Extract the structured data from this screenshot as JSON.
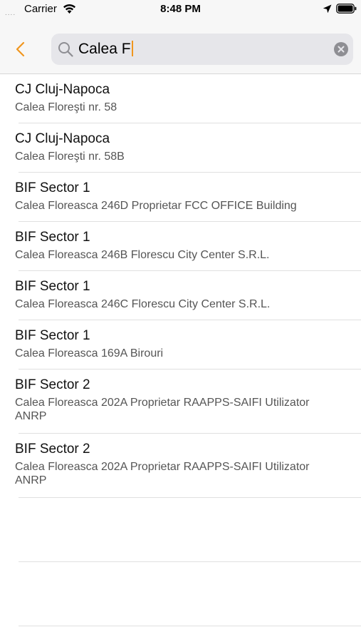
{
  "status_bar": {
    "signal": "....",
    "carrier": "Carrier",
    "time": "8:48 PM",
    "wifi_icon": "wifi-icon",
    "location_icon": "location-arrow-icon",
    "battery_icon": "battery-full-icon"
  },
  "nav": {
    "back_icon": "chevron-left-icon",
    "accent_color": "#f0961e"
  },
  "search": {
    "value": "Calea F",
    "search_icon": "magnifier-icon",
    "clear_icon": "clear-circle-icon"
  },
  "results": [
    {
      "title": "CJ Cluj-Napoca",
      "subtitle": "Calea Floreşti nr. 58"
    },
    {
      "title": "CJ Cluj-Napoca",
      "subtitle": "Calea Floreşti nr. 58B"
    },
    {
      "title": "BIF Sector 1",
      "subtitle": "Calea Floreasca 246D Proprietar FCC OFFICE Building"
    },
    {
      "title": "BIF Sector 1",
      "subtitle": "Calea Floreasca 246B Florescu City Center S.R.L."
    },
    {
      "title": "BIF Sector 1",
      "subtitle": "Calea Floreasca 246C Florescu City Center S.R.L."
    },
    {
      "title": "BIF Sector 1",
      "subtitle": "Calea Floreasca 169A Birouri"
    },
    {
      "title": "BIF Sector 2",
      "subtitle": "Calea Floreasca 202A Proprietar RAAPPS-SAIFI Utilizator ANRP"
    },
    {
      "title": "BIF Sector 2",
      "subtitle": "Calea Floreasca 202A Proprietar RAAPPS-SAIFI Utilizator ANRP"
    }
  ]
}
